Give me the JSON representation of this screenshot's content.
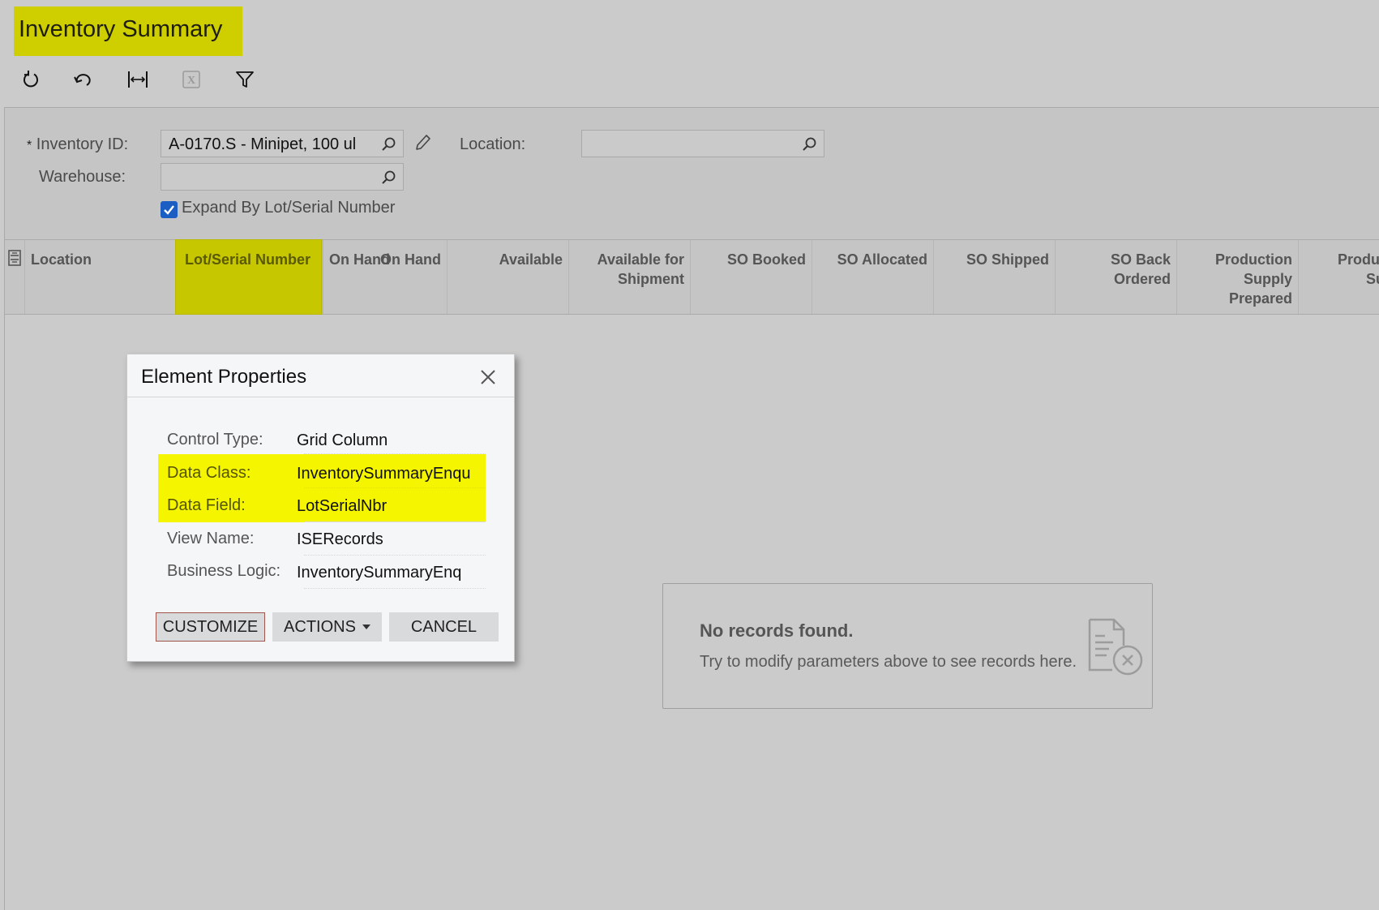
{
  "header": {
    "title": "Inventory Summary",
    "title_highlight_color": "#cfcf00"
  },
  "toolbar": {
    "items": [
      {
        "icon": "refresh-icon",
        "label": "Refresh"
      },
      {
        "icon": "undo-icon",
        "label": "Undo"
      },
      {
        "icon": "fit-width-icon",
        "label": "Adjust Columns"
      },
      {
        "icon": "excel-export-icon",
        "label": "Export to Excel",
        "disabled": true
      },
      {
        "icon": "filter-icon",
        "label": "Filter"
      }
    ]
  },
  "form": {
    "inventory_id": {
      "label": "Inventory ID:",
      "required_marker": "*",
      "value": "A-0170.S - Minipet, 100 ul"
    },
    "warehouse": {
      "label": "Warehouse:",
      "value": ""
    },
    "location": {
      "label": "Location:",
      "value": ""
    },
    "expand_by_lot": {
      "label": "Expand By Lot/Serial Number",
      "checked": true
    }
  },
  "grid": {
    "columns": [
      {
        "label": "Location"
      },
      {
        "label": "Lot/Serial Number",
        "highlighted": true
      },
      {
        "label": "On Hand"
      },
      {
        "label": "Available"
      },
      {
        "label": "Available for Shipment"
      },
      {
        "label": "SO Booked"
      },
      {
        "label": "SO Allocated"
      },
      {
        "label": "SO Shipped"
      },
      {
        "label": "SO Back Ordered"
      },
      {
        "label": "Production Supply Prepared"
      },
      {
        "label": "Production Su"
      }
    ],
    "empty": {
      "title": "No records found.",
      "message": "Try to modify parameters above to see records here."
    }
  },
  "dialog": {
    "title": "Element Properties",
    "properties": [
      {
        "label": "Control Type:",
        "value": "Grid Column",
        "highlighted": false
      },
      {
        "label": "Data Class:",
        "value": "InventorySummaryEnquiryResult",
        "highlighted": true
      },
      {
        "label": "Data Field:",
        "value": "LotSerialNbr",
        "highlighted": true
      },
      {
        "label": "View Name:",
        "value": "ISERecords",
        "highlighted": false
      },
      {
        "label": "Business Logic:",
        "value": "InventorySummaryEnq",
        "highlighted": false
      }
    ],
    "buttons": {
      "customize": "CUSTOMIZE",
      "actions": "ACTIONS",
      "cancel": "CANCEL"
    },
    "highlight_color": "#f5f500"
  }
}
